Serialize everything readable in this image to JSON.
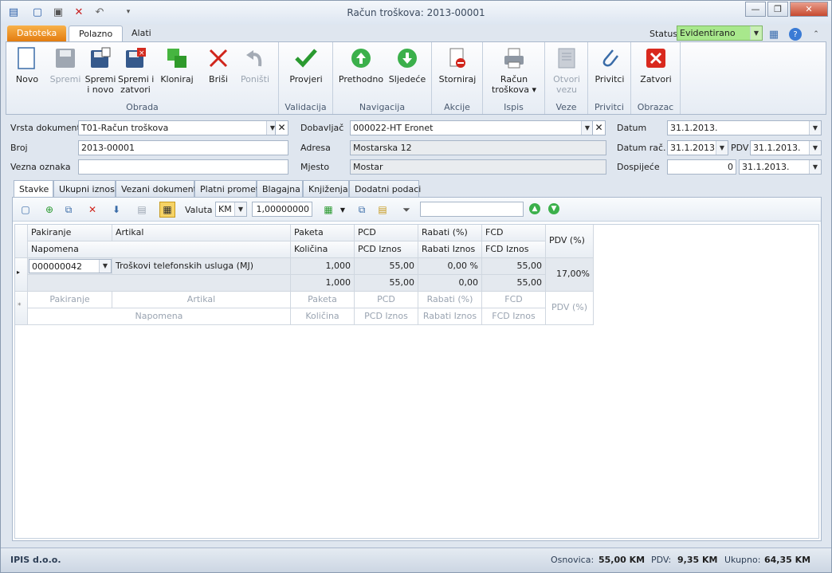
{
  "window": {
    "title": "Račun troškova: 2013-00001",
    "minimize_icon": "minimize-icon",
    "maximize_icon": "maximize-icon",
    "close_icon": "close-icon"
  },
  "ribbon_tabs": [
    "Datoteka",
    "Polazno",
    "Alati"
  ],
  "status": {
    "label": "Status",
    "value": "Evidentirano"
  },
  "groups": [
    {
      "label": "Obrada",
      "buttons": [
        "Novo",
        "Spremi",
        "Spremi\ni novo",
        "Spremi i\nzatvori",
        "Kloniraj",
        "Briši",
        "Poništi"
      ]
    },
    {
      "label": "Validacija",
      "buttons": [
        "Provjeri"
      ]
    },
    {
      "label": "Navigacija",
      "buttons": [
        "Prethodno",
        "Sljedeće"
      ]
    },
    {
      "label": "Akcije",
      "buttons": [
        "Storniraj"
      ]
    },
    {
      "label": "Ispis",
      "buttons": [
        "Račun\ntroškova ▾"
      ]
    },
    {
      "label": "Veze",
      "buttons": [
        "Otvori\nvezu"
      ]
    },
    {
      "label": "Privitci",
      "buttons": [
        "Privitci"
      ]
    },
    {
      "label": "Obrazac",
      "buttons": [
        "Zatvori"
      ]
    }
  ],
  "form": {
    "vrsta_label": "Vrsta dokumenta",
    "vrsta_value": "T01-Račun troškova",
    "broj_label": "Broj",
    "broj_value": "2013-00001",
    "vezna_label": "Vezna oznaka",
    "vezna_value": "",
    "dobavljac_label": "Dobavljač",
    "dobavljac_value": "000022-HT Eronet",
    "adresa_label": "Adresa",
    "adresa_value": "Mostarska 12",
    "mjesto_label": "Mjesto",
    "mjesto_value": "Mostar",
    "datum_label": "Datum",
    "datum_value": "31.1.2013.",
    "datum_rac_label": "Datum rač.",
    "datum_rac_value": "31.1.2013.",
    "pdv_label": "PDV",
    "pdv_value": "31.1.2013.",
    "dospijece_label": "Dospijeće",
    "dospijece_days": "0",
    "dospijece_value": "31.1.2013."
  },
  "doc_tabs": [
    "Stavke",
    "Ukupni iznosi",
    "Vezani dokumenti",
    "Platni promet",
    "Blagajna",
    "Knjiženja",
    "Dodatni podaci"
  ],
  "toolbar": {
    "valuta_label": "Valuta",
    "valuta_value": "KM",
    "rate_value": "1,00000000",
    "search_value": ""
  },
  "grid": {
    "headers_row1": [
      "Pakiranje",
      "Artikal",
      "Paketa",
      "PCD",
      "Rabati (%)",
      "FCD",
      "PDV (%)"
    ],
    "headers_row2": [
      "Napomena",
      "Količina",
      "PCD Iznos",
      "Rabati Iznos",
      "FCD Iznos"
    ],
    "row": {
      "pakiranje": "000000042",
      "artikal": "Troškovi telefonskih usluga (MJ)",
      "paketa": "1,000",
      "pcd": "55,00",
      "rabati": "0,00 %",
      "fcd": "55,00",
      "kolicina": "1,000",
      "pcd_iznos": "55,00",
      "rabati_iznos": "0,00",
      "fcd_iznos": "55,00",
      "pdv": "17,00%"
    },
    "new_row1": [
      "Pakiranje",
      "Artikal",
      "Paketa",
      "PCD",
      "Rabati (%)",
      "FCD",
      "PDV (%)"
    ],
    "new_row2": [
      "Napomena",
      "Količina",
      "PCD Iznos",
      "Rabati Iznos",
      "FCD Iznos"
    ]
  },
  "statusbar": {
    "company": "IPIS d.o.o.",
    "osnovica_label": "Osnovica:",
    "osnovica_value": "55,00 KM",
    "pdv_label": "PDV:",
    "pdv_value": "9,35 KM",
    "ukupno_label": "Ukupno:",
    "ukupno_value": "64,35 KM"
  }
}
